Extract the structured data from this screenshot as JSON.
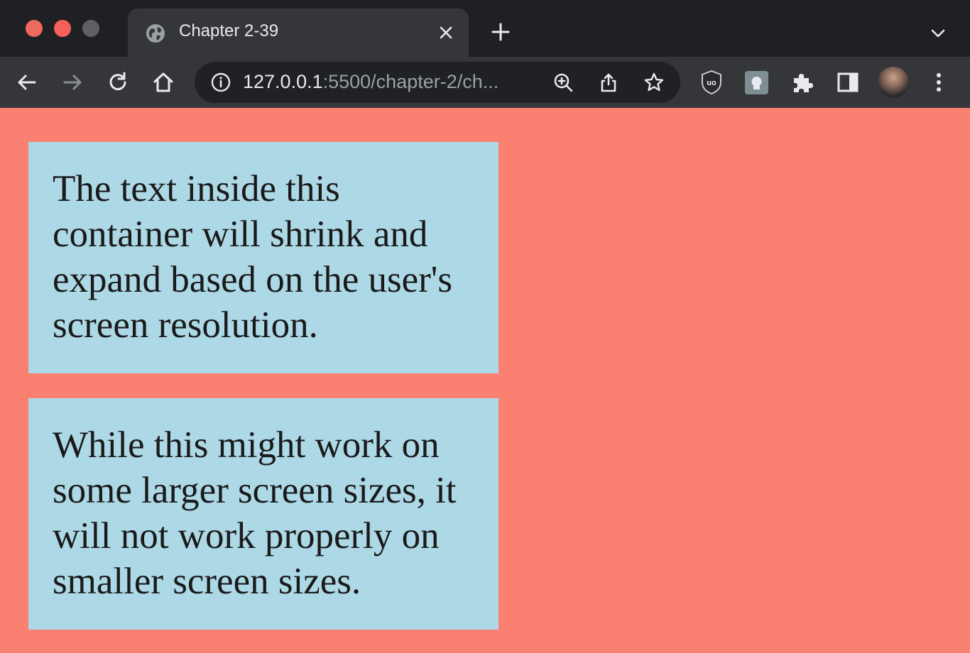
{
  "browser": {
    "tab": {
      "title": "Chapter 2-39",
      "favicon": "globe-icon"
    },
    "address_bar": {
      "host": "127.0.0.1",
      "rest": ":5500/chapter-2/ch..."
    },
    "toolbar_icons": [
      "back-icon",
      "forward-icon",
      "reload-icon",
      "home-icon",
      "info-icon",
      "zoom-icon",
      "share-icon",
      "star-icon",
      "ublock-icon",
      "extension-square-icon",
      "puzzle-icon",
      "side-panel-icon",
      "avatar",
      "menu-icon"
    ]
  },
  "page": {
    "background_color": "#fa8072",
    "box_color": "#add8e6",
    "boxes": [
      {
        "text": "The text inside this container will shrink and expand based on the user's screen resolution."
      },
      {
        "text": "While this might work on some larger screen sizes, it will not work properly on smaller screen sizes."
      }
    ]
  }
}
